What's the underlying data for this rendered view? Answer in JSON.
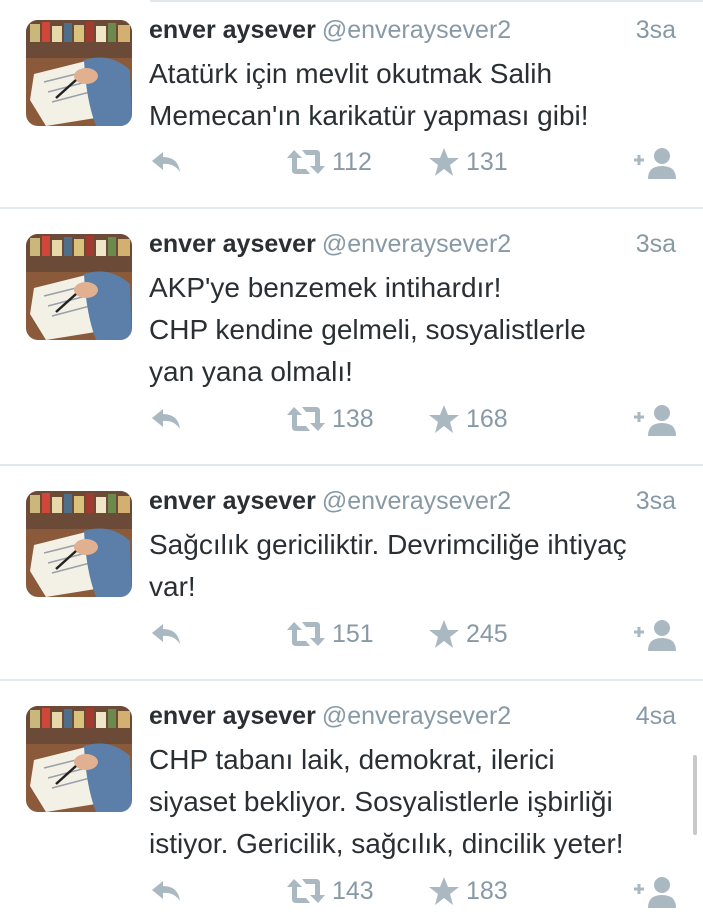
{
  "colors": {
    "text": "#292f33",
    "secondary": "#8899a6",
    "icon": "#aab8c2",
    "divider": "#e1e8ed"
  },
  "tweets": [
    {
      "name": "enver aysever",
      "handle": "@enveraysever2",
      "time": "3sa",
      "lines": [
        "Atatürk için mevlit okutmak Salih",
        "Memecan'ın karikatür yapması gibi!"
      ],
      "retweets": "112",
      "favorites": "131"
    },
    {
      "name": "enver aysever",
      "handle": "@enveraysever2",
      "time": "3sa",
      "lines": [
        "AKP'ye benzemek intihardır!",
        "CHP kendine gelmeli, sosyalistlerle",
        "yan yana olmalı!"
      ],
      "retweets": "138",
      "favorites": "168"
    },
    {
      "name": "enver aysever",
      "handle": "@enveraysever2",
      "time": "3sa",
      "lines": [
        "Sağcılık gericiliktir. Devrimciliğe ihtiyaç",
        "var!"
      ],
      "retweets": "151",
      "favorites": "245"
    },
    {
      "name": "enver aysever",
      "handle": "@enveraysever2",
      "time": "4sa",
      "lines": [
        "CHP tabanı laik, demokrat, ilerici",
        "siyaset bekliyor. Sosyalistlerle işbirliği",
        "istiyor. Gericilik, sağcılık, dincilik yeter!"
      ],
      "retweets": "143",
      "favorites": "183"
    }
  ],
  "icons": {
    "reply": "reply-icon",
    "retweet": "retweet-icon",
    "favorite": "star-icon",
    "follow": "follow-user-icon"
  }
}
